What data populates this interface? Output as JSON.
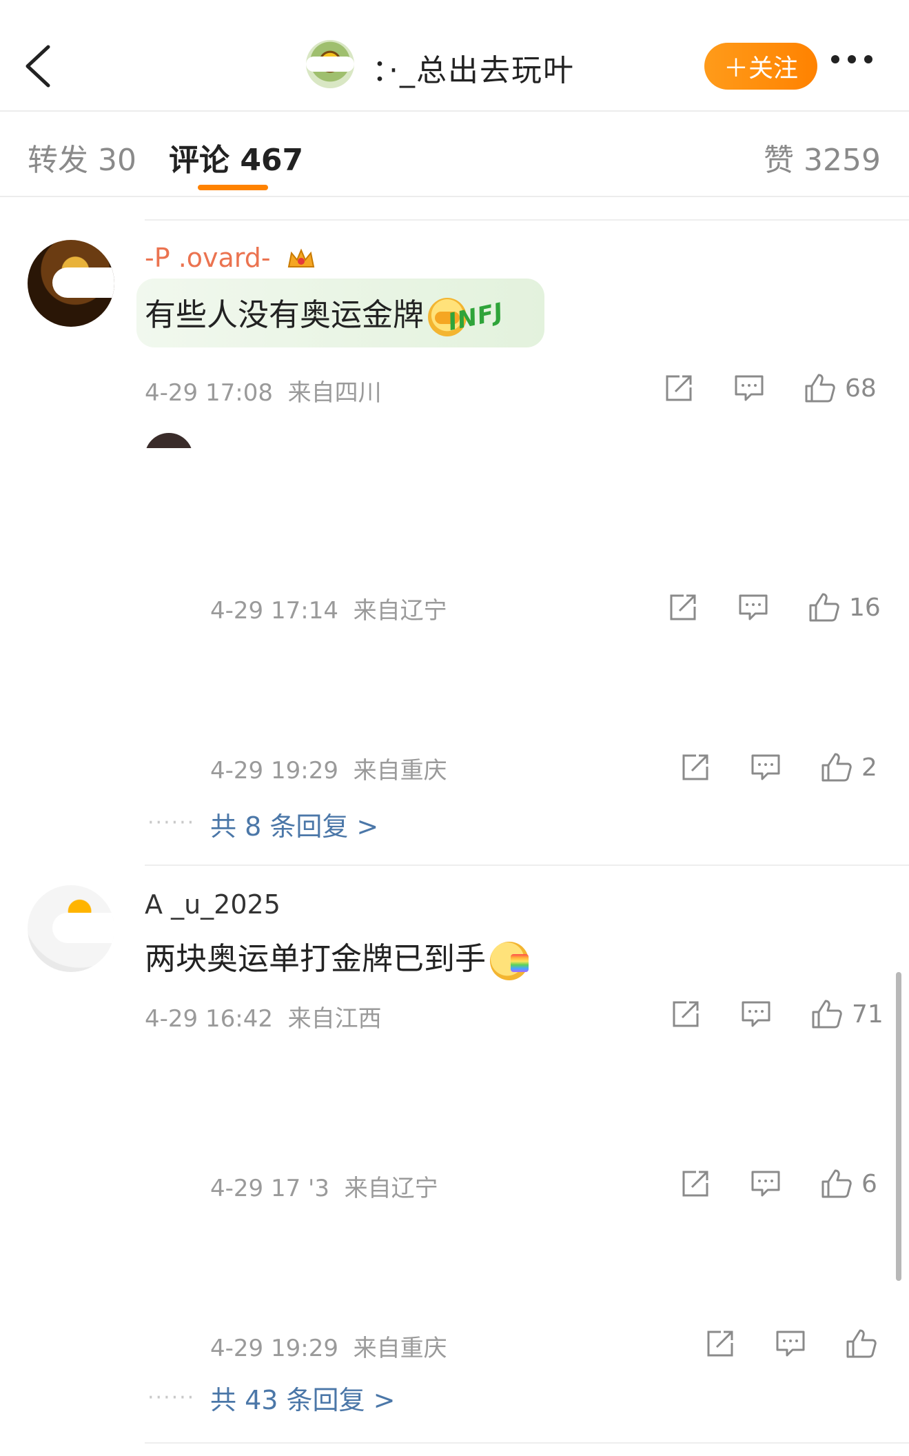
{
  "header": {
    "user_name": "：·_总出去玩叶",
    "follow_label": "＋关注"
  },
  "tabs": [
    {
      "label": "转发 30"
    },
    {
      "label": "评论 467"
    },
    {
      "label": "赞 3259"
    }
  ],
  "comments": [
    {
      "user": "-P  .ovard-",
      "text": "有些人没有奥运金牌",
      "badge": "INFJ",
      "time": "4-29 17:08",
      "location": "来自四川",
      "likes": "68",
      "replies": [
        {
          "time": "4-29 17:14",
          "location": "来自辽宁",
          "likes": "16"
        },
        {
          "time": "4-29 19:29",
          "location": "来自重庆",
          "likes": "2"
        }
      ],
      "more_replies": "共 8 条回复 >"
    },
    {
      "user": "A   _u_2025",
      "text": "两块奥运单打金牌已到手",
      "time": "4-29 16:42",
      "location": "来自江西",
      "likes": "71",
      "replies": [
        {
          "time": "4-29 17 '3",
          "location": "来自辽宁",
          "likes": "6"
        },
        {
          "time": "4-29 19:29",
          "location": "来自重庆",
          "likes": ""
        }
      ],
      "more_replies": "共 43 条回复 >"
    }
  ],
  "dots": "······",
  "colors": {
    "accent": "#ff8200",
    "link": "#4b77a8",
    "username": "#eb7350"
  },
  "icons": [
    "back-arrow-icon",
    "more-icon",
    "repost-icon",
    "reply-icon",
    "like-icon",
    "crown-icon"
  ]
}
